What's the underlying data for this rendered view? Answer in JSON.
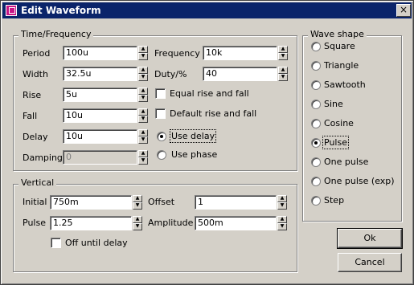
{
  "window": {
    "title": "Edit Waveform",
    "close_glyph": "×"
  },
  "time_group": {
    "legend": "Time/Frequency",
    "period": {
      "label": "Period",
      "value": "100u"
    },
    "width": {
      "label": "Width",
      "value": "32.5u"
    },
    "rise": {
      "label": "Rise",
      "value": "5u"
    },
    "fall": {
      "label": "Fall",
      "value": "10u"
    },
    "delay": {
      "label": "Delay",
      "value": "10u"
    },
    "damping": {
      "label": "Damping",
      "value": "0"
    },
    "frequency": {
      "label": "Frequency",
      "value": "10k"
    },
    "duty": {
      "label": "Duty/%",
      "value": "40"
    },
    "equal_rise_fall": {
      "label": "Equal rise and fall",
      "checked": false
    },
    "default_rise_fall": {
      "label": "Default rise and fall",
      "checked": false
    },
    "use_delay": {
      "label": "Use delay",
      "selected": true
    },
    "use_phase": {
      "label": "Use phase",
      "selected": false
    }
  },
  "vertical_group": {
    "legend": "Vertical",
    "initial": {
      "label": "Initial",
      "value": "750m"
    },
    "pulse": {
      "label": "Pulse",
      "value": "1.25"
    },
    "offset": {
      "label": "Offset",
      "value": "1"
    },
    "amplitude": {
      "label": "Amplitude",
      "value": "500m"
    },
    "off_until_delay": {
      "label": "Off until delay",
      "checked": false
    }
  },
  "wave_shape": {
    "legend": "Wave shape",
    "options": [
      {
        "label": "Square",
        "selected": false
      },
      {
        "label": "Triangle",
        "selected": false
      },
      {
        "label": "Sawtooth",
        "selected": false
      },
      {
        "label": "Sine",
        "selected": false
      },
      {
        "label": "Cosine",
        "selected": false
      },
      {
        "label": "Pulse",
        "selected": true
      },
      {
        "label": "One pulse",
        "selected": false
      },
      {
        "label": "One pulse (exp)",
        "selected": false
      },
      {
        "label": "Step",
        "selected": false
      }
    ]
  },
  "buttons": {
    "ok": "Ok",
    "cancel": "Cancel"
  },
  "spin_glyphs": {
    "up": "▲",
    "down": "▼"
  }
}
